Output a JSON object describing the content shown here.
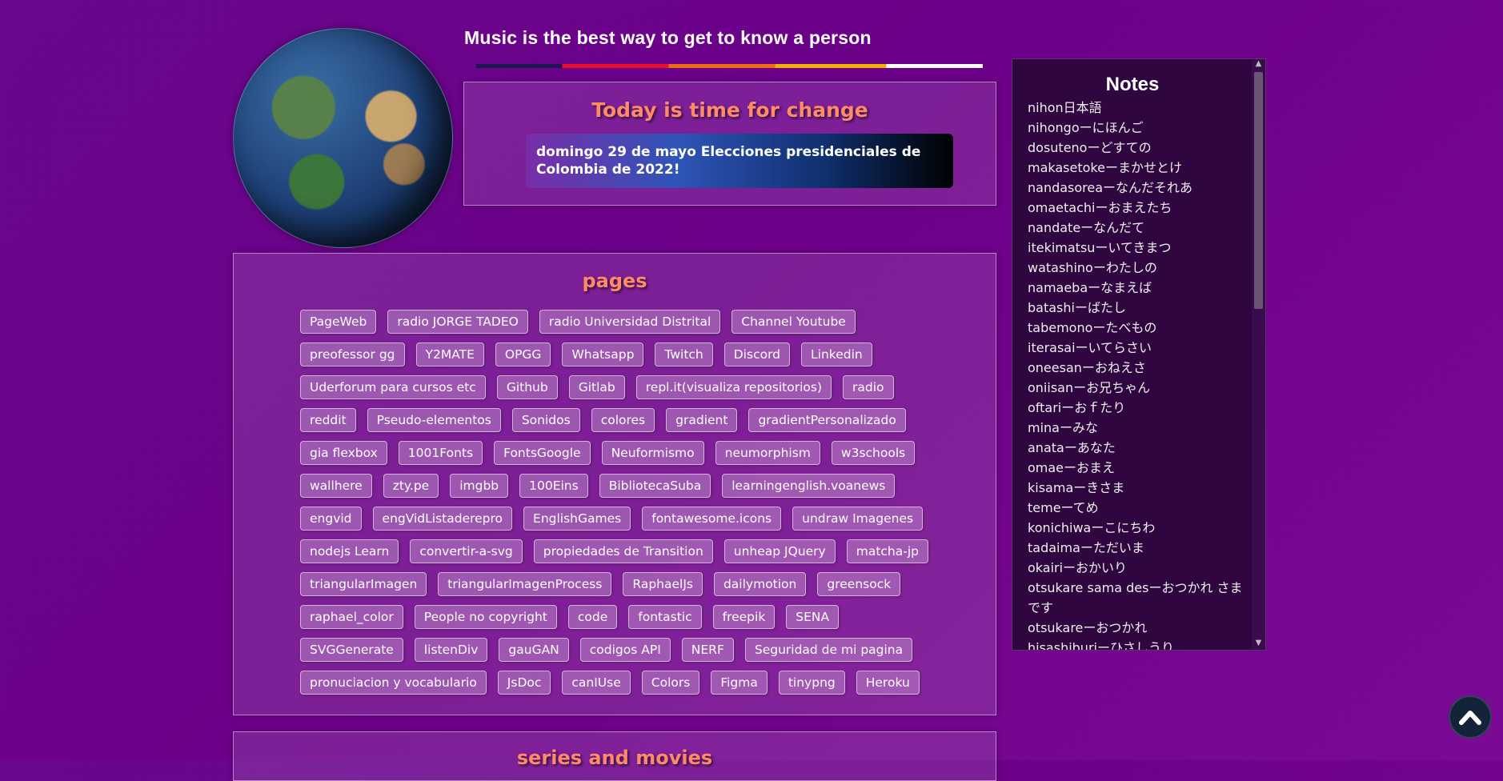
{
  "header": {
    "headline": "Music is the best way to get to know a person"
  },
  "change": {
    "title": "Today is time for change",
    "election_text": "domingo 29 de mayo Elecciones presidenciales de Colombia de 2022!"
  },
  "pages": {
    "title": "pages",
    "links": [
      "PageWeb",
      "radio JORGE TADEO",
      "radio Universidad Distrital",
      "Channel Youtube",
      "preofessor gg",
      "Y2MATE",
      "OPGG",
      "Whatsapp",
      "Twitch",
      "Discord",
      "Linkedin",
      "Uderforum para cursos etc",
      "Github",
      "Gitlab",
      "repl.it(visualiza repositorios)",
      "radio",
      "reddit",
      "Pseudo-elementos",
      "Sonidos",
      "colores",
      "gradient",
      "gradientPersonalizado",
      "gia flexbox",
      "1001Fonts",
      "FontsGoogle",
      "Neuformismo",
      "neumorphism",
      "w3schools",
      "wallhere",
      "zty.pe",
      "imgbb",
      "100Eins",
      "BibliotecaSuba",
      "learningenglish.voanews",
      "engvid",
      "engVidListaderepro",
      "EnglishGames",
      "fontawesome.icons",
      "undraw Imagenes",
      "nodejs Learn",
      "convertir-a-svg",
      "propiedades de Transition",
      "unheap JQuery",
      "matcha-jp",
      "triangularImagen",
      "triangularImagenProcess",
      "RaphaelJs",
      "dailymotion",
      "greensock",
      "raphael_color",
      "People no copyright",
      "code",
      "fontastic",
      "freepik",
      "SENA",
      "SVGGenerate",
      "listenDiv",
      "gauGAN",
      "codigos API",
      "NERF",
      "Seguridad de mi pagina",
      "pronuciacion y vocabulario",
      "JsDoc",
      "canIUse",
      "Colors",
      "Figma",
      "tinypng",
      "Heroku"
    ]
  },
  "series": {
    "title": "series and movies"
  },
  "notes": {
    "title": "Notes",
    "items": [
      "nihon日本語",
      "nihongoーにほんご",
      "dosutenoーどすての",
      "makasetokeーまかせとけ",
      "nandasoreaーなんだそれあ",
      "omaetachiーおまえたち",
      "nandateーなんだて",
      "itekimatsuーいてきまつ",
      "watashinoーわたしの",
      "namaebaーなまえば",
      "batashiーばたし",
      "tabemonoーたべもの",
      "iterasaiーいてらさい",
      "oneesanーおねえさ",
      "oniisanーお兄ちゃん",
      "oftariーおｆたり",
      "minaーみな",
      "anataーあなた",
      "omaeーおまえ",
      "kisamaーきさま",
      "temeーてめ",
      "konichiwaーこにちわ",
      "tadaimaーただいま",
      "okairiーおかいり",
      "otsukare sama desーおつかれ さま　です",
      "otsukareーおつかれ",
      "hisashiburiーひさしうり"
    ]
  },
  "colors": {
    "background": "#6c0088",
    "accent_title": "#ff8a6a",
    "notes_bg": "#2f0640",
    "to_top_bg": "#13233a"
  },
  "icons": {
    "globe": "globe-image",
    "scroll_to_top": "chevron-up-icon"
  }
}
